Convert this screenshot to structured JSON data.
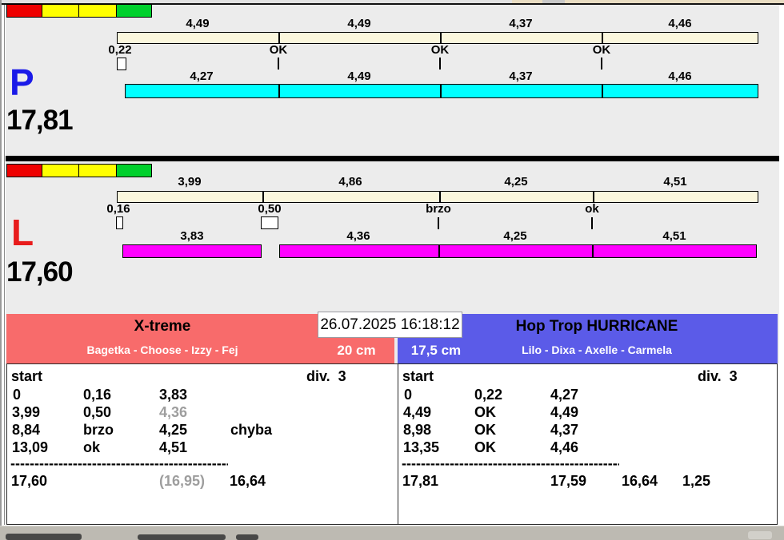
{
  "colors": {
    "panel_bg": "#ececec",
    "ref_bar_fill": "#fbf7dd",
    "lane_p_bar": "#00ffff",
    "lane_l_bar": "#ff00ff",
    "lane_p_letter": "#1a1ae8",
    "lane_l_letter": "#e81c1c",
    "team_left_bg": "#f86b6b",
    "team_right_bg": "#5b5be8",
    "light_red": "#ee0000",
    "light_yellow": "#ffff00",
    "light_green": "#00d02c"
  },
  "lanes": {
    "p": {
      "letter": "P",
      "total": "17,81",
      "lights": [
        "#ee0000",
        "#ffff00",
        "#ffff00",
        "#00d02c"
      ],
      "ref_labels": [
        "4,49",
        "4,49",
        "4,37",
        "4,46"
      ],
      "marks": [
        "0,22",
        "OK",
        "OK",
        "OK"
      ],
      "run_labels": [
        "4,27",
        "4,49",
        "4,37",
        "4,46"
      ]
    },
    "l": {
      "letter": "L",
      "total": "17,60",
      "lights": [
        "#ee0000",
        "#ffff00",
        "#ffff00",
        "#00d02c"
      ],
      "ref_labels": [
        "3,99",
        "4,86",
        "4,25",
        "4,51"
      ],
      "marks": [
        "0,16",
        "0,50",
        "brzo",
        "ok"
      ],
      "run_labels": [
        "3,83",
        "4,36",
        "4,25",
        "4,51"
      ]
    }
  },
  "header": {
    "datetime": "26.07.2025 16:18:12",
    "team_left": {
      "name": "X-treme",
      "dogs": "Bagetka - Choose - Izzy - Fej",
      "height": "20 cm"
    },
    "team_right": {
      "name": "Hop Trop HURRICANE",
      "dogs": "Lilo - Dixa - Axelle - Carmela",
      "height": "17,5 cm"
    }
  },
  "tables": {
    "left": {
      "start_label": "start",
      "div_label": "div.  3",
      "rows": [
        [
          "0",
          "0,16",
          "3,83",
          ""
        ],
        [
          "3,99",
          "0,50",
          "4,36",
          ""
        ],
        [
          "8,84",
          "brzo",
          "4,25",
          "chyba"
        ],
        [
          "13,09",
          "ok",
          "4,51",
          ""
        ]
      ],
      "separator": "---------------------------------------------------------",
      "totals": [
        "17,60",
        "(16,95)",
        "16,64",
        ""
      ]
    },
    "right": {
      "start_label": "start",
      "div_label": "div.  3",
      "rows": [
        [
          "0",
          "0,22",
          "4,27",
          ""
        ],
        [
          "4,49",
          "OK",
          "4,49",
          ""
        ],
        [
          "8,98",
          "OK",
          "4,37",
          ""
        ],
        [
          "13,35",
          "OK",
          "4,46",
          ""
        ]
      ],
      "separator": "---------------------------------------------------------",
      "totals": [
        "17,81",
        "17,59",
        "16,64",
        "1,25"
      ]
    }
  }
}
